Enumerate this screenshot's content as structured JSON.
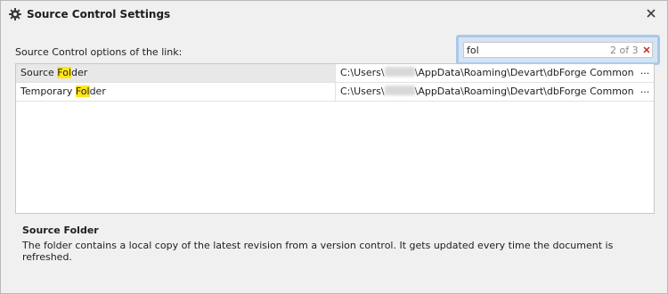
{
  "window": {
    "title": "Source Control Settings",
    "title_icon": "gear-icon",
    "close_icon": "close-icon"
  },
  "options_label": "Source Control options of the link:",
  "search": {
    "value": "fol",
    "match_count": "2 of 3",
    "clear_icon": "clear-x-icon",
    "border_color": "#aac8e8",
    "clear_color": "#c62828"
  },
  "grid": {
    "rows": [
      {
        "name_before": "Source ",
        "name_match": "Fol",
        "name_after": "der",
        "value_before": "C:\\Users\\",
        "value_after": "\\AppData\\Roaming\\Devart\\dbForge Common Settin...",
        "button_label": "···"
      },
      {
        "name_before": "Temporary ",
        "name_match": "Fol",
        "name_after": "der",
        "value_before": "C:\\Users\\",
        "value_after": "\\AppData\\Roaming\\Devart\\dbForge Common Settin...",
        "button_label": "···"
      }
    ],
    "highlight_color": "#ffe41c"
  },
  "description": {
    "title": "Source Folder",
    "text": "The folder contains a local copy of the latest revision from a version control. It gets updated every time the document is refreshed."
  }
}
